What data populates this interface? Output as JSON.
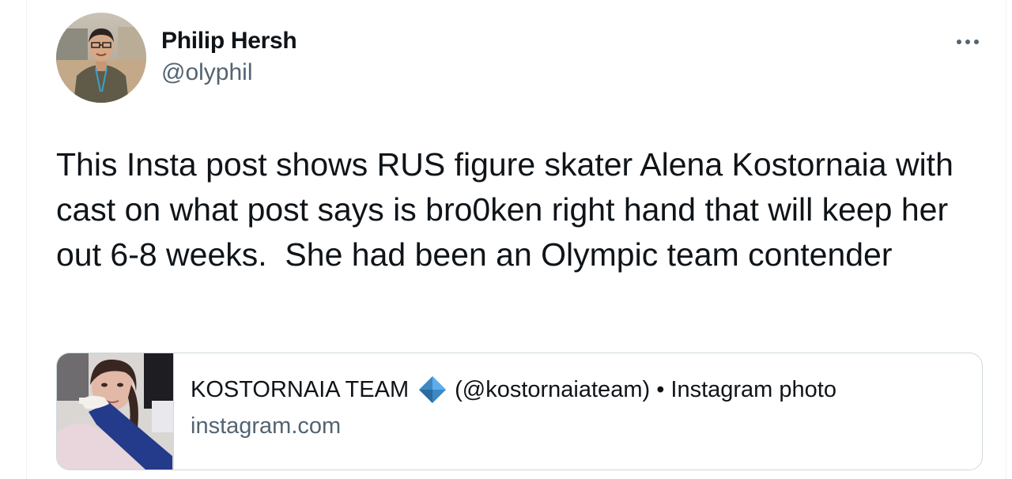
{
  "tweet": {
    "author": {
      "name": "Philip Hersh",
      "handle": "@olyphil",
      "avatar_icon": "profile-photo"
    },
    "more_icon": "more-options-icon",
    "text": "This Insta post shows RUS figure skater Alena Kostornaia with cast on what post says is bro0ken right hand that will keep her out 6-8 weeks.  She had been an Olympic team contender"
  },
  "link_card": {
    "title_before_badge": "KOSTORNAIA TEAM",
    "title_after_badge": "(@kostornaiateam) • Instagram photo",
    "badge_icon": "blue-diamond-icon",
    "domain": "instagram.com",
    "thumbnail_icon": "skater-with-cast-photo"
  },
  "colors": {
    "text_primary": "#0f1419",
    "text_secondary": "#536471",
    "border": "#cfd9de",
    "badge_blue": "#3b88c3"
  }
}
